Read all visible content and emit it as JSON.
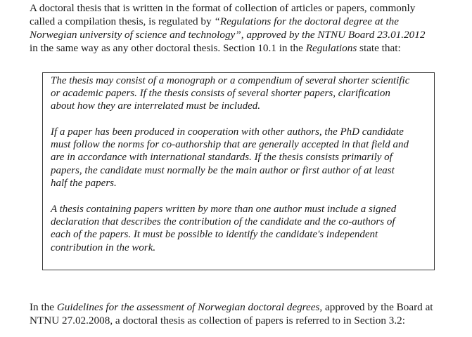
{
  "intro": {
    "l1": "A doctoral thesis that is written in the format of collection of articles or papers, commonly",
    "l2_a": "called a compilation thesis, is regulated by  ",
    "l2_b": "“Regulations for the doctoral degree at the",
    "l3": "Norwegian university of science and technology”, approved by the NTNU Board 23.01.2012",
    "l4_a": "in the same way as any other doctoral thesis. Section 10.1 in the ",
    "l4_b": "Regulations",
    "l4_c": " state that:"
  },
  "quote": {
    "p1": [
      "The thesis may consist of a monograph or a compendium of several shorter scientific",
      "or academic papers. If the thesis consists of several shorter papers, clarification",
      "about how they are interrelated must be included."
    ],
    "p2": [
      "If a paper has been produced in cooperation with other authors, the PhD candidate",
      "must follow the norms for co-authorship that are generally accepted in that field and",
      "are in accordance with international standards. If the thesis consists primarily of",
      "papers, the candidate must normally be the main author or first author of at least",
      "half the papers."
    ],
    "p3": [
      "A thesis containing papers written by more than one author must include a signed",
      "declaration that describes the contribution of the candidate and the co-authors of",
      "each of the papers. It must be possible to identify the candidate's independent",
      "contribution in the work."
    ]
  },
  "outro": {
    "l1_a": "In the ",
    "l1_b": "Guidelines for the assessment of Norwegian doctoral degrees",
    "l1_c": ", approved by the Board at",
    "l2": "NTNU 27.02.2008, a doctoral thesis as collection of papers is referred to in Section 3.2:"
  }
}
